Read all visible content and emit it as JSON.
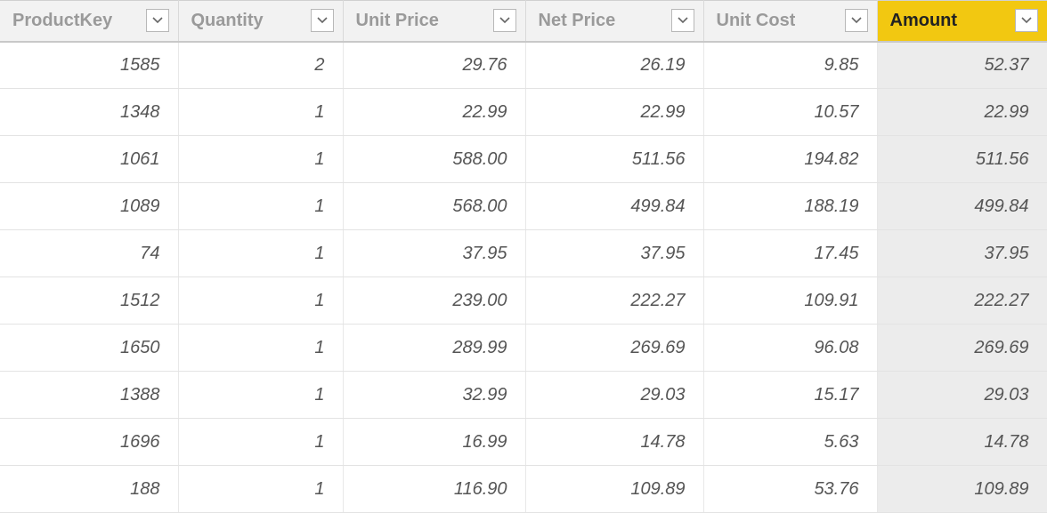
{
  "table": {
    "columns": [
      {
        "label": "ProductKey",
        "selected": false
      },
      {
        "label": "Quantity",
        "selected": false
      },
      {
        "label": "Unit Price",
        "selected": false
      },
      {
        "label": "Net Price",
        "selected": false
      },
      {
        "label": "Unit Cost",
        "selected": false
      },
      {
        "label": "Amount",
        "selected": true
      }
    ],
    "rows": [
      {
        "cells": [
          "1585",
          "2",
          "29.76",
          "26.19",
          "9.85",
          "52.37"
        ]
      },
      {
        "cells": [
          "1348",
          "1",
          "22.99",
          "22.99",
          "10.57",
          "22.99"
        ]
      },
      {
        "cells": [
          "1061",
          "1",
          "588.00",
          "511.56",
          "194.82",
          "511.56"
        ]
      },
      {
        "cells": [
          "1089",
          "1",
          "568.00",
          "499.84",
          "188.19",
          "499.84"
        ]
      },
      {
        "cells": [
          "74",
          "1",
          "37.95",
          "37.95",
          "17.45",
          "37.95"
        ]
      },
      {
        "cells": [
          "1512",
          "1",
          "239.00",
          "222.27",
          "109.91",
          "222.27"
        ]
      },
      {
        "cells": [
          "1650",
          "1",
          "289.99",
          "269.69",
          "96.08",
          "269.69"
        ]
      },
      {
        "cells": [
          "1388",
          "1",
          "32.99",
          "29.03",
          "15.17",
          "29.03"
        ]
      },
      {
        "cells": [
          "1696",
          "1",
          "16.99",
          "14.78",
          "5.63",
          "14.78"
        ]
      },
      {
        "cells": [
          "188",
          "1",
          "116.90",
          "109.89",
          "53.76",
          "109.89"
        ]
      }
    ]
  },
  "chart_data": {
    "type": "table",
    "columns": [
      "ProductKey",
      "Quantity",
      "Unit Price",
      "Net Price",
      "Unit Cost",
      "Amount"
    ],
    "rows": [
      [
        1585,
        2,
        29.76,
        26.19,
        9.85,
        52.37
      ],
      [
        1348,
        1,
        22.99,
        22.99,
        10.57,
        22.99
      ],
      [
        1061,
        1,
        588.0,
        511.56,
        194.82,
        511.56
      ],
      [
        1089,
        1,
        568.0,
        499.84,
        188.19,
        499.84
      ],
      [
        74,
        1,
        37.95,
        37.95,
        17.45,
        37.95
      ],
      [
        1512,
        1,
        239.0,
        222.27,
        109.91,
        222.27
      ],
      [
        1650,
        1,
        289.99,
        269.69,
        96.08,
        269.69
      ],
      [
        1388,
        1,
        32.99,
        29.03,
        15.17,
        29.03
      ],
      [
        1696,
        1,
        16.99,
        14.78,
        5.63,
        14.78
      ],
      [
        188,
        1,
        116.9,
        109.89,
        53.76,
        109.89
      ]
    ]
  }
}
